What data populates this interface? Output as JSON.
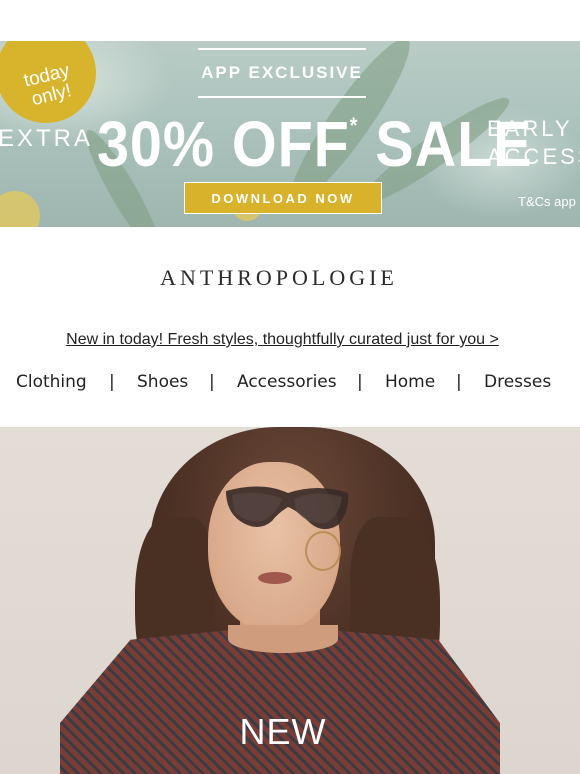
{
  "banner": {
    "badge_text": "today\nonly!",
    "exclusive_label": "APP EXCLUSIVE",
    "extra_label": "EXTRA",
    "headline": "30% OFF",
    "headline_mark": "*",
    "headline_tail": "SALE",
    "early_line1": "EARLY",
    "early_line2": "ACCESS",
    "download_label": "DOWNLOAD NOW",
    "terms_text": "T&Cs app",
    "colors": {
      "badge": "#d8b42c",
      "button": "#d8b22a",
      "background": "#b9ccc6"
    }
  },
  "logo": {
    "text": "ANTHROPOLOGIE"
  },
  "promo": {
    "text": "New in today! Fresh styles, thoughtfully curated just for you >"
  },
  "nav": {
    "separator": "|",
    "items": [
      {
        "label": "Clothing"
      },
      {
        "label": "Shoes"
      },
      {
        "label": "Accessories"
      },
      {
        "label": "Home"
      },
      {
        "label": "Dresses"
      }
    ]
  },
  "hero": {
    "overlay_text": "NEW"
  }
}
